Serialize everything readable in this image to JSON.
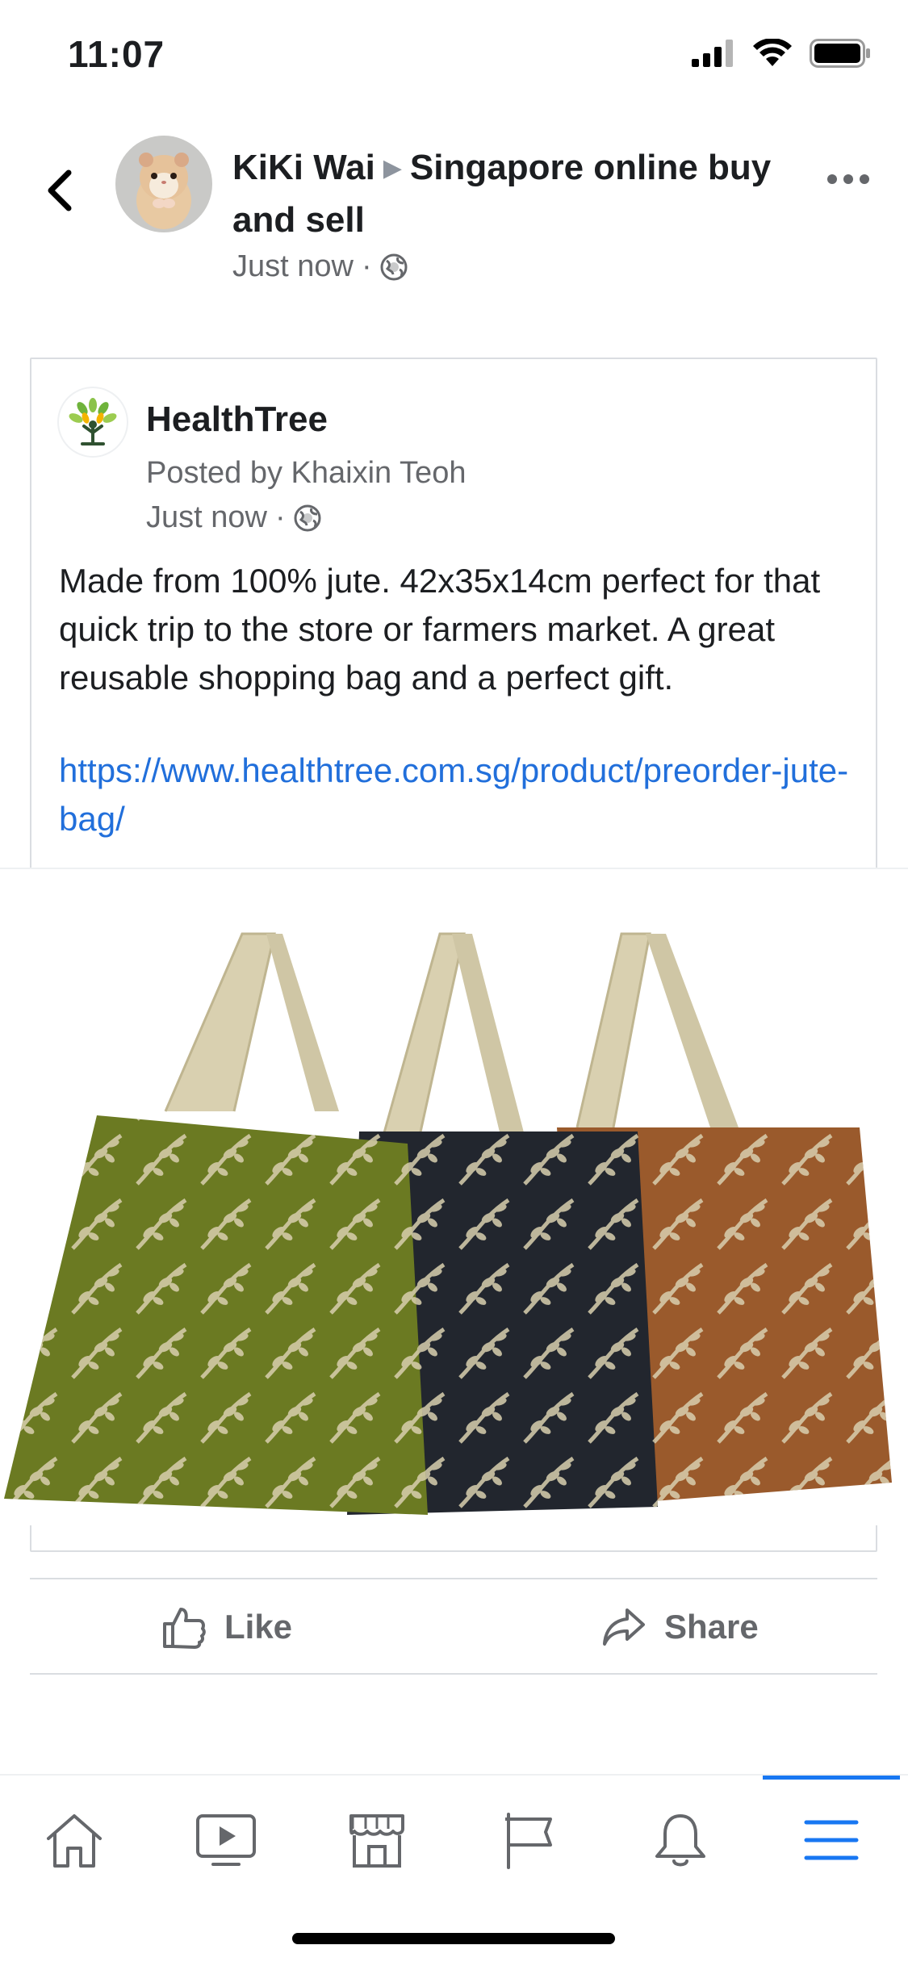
{
  "status_bar": {
    "time": "11:07"
  },
  "header": {
    "author": "KiKi Wai",
    "group": "Singapore online buy and sell",
    "timestamp": "Just now",
    "privacy_icon": "globe-icon"
  },
  "shared_post": {
    "page_name": "HealthTree",
    "posted_by": "Posted by Khaixin Teoh",
    "timestamp": "Just now",
    "body": "Made from 100% jute. 42x35x14cm perfect for that quick trip to the store or farmers market. A great reusable shopping bag and a perfect gift.",
    "link": "https://www.healthtree.com.sg/product/preorder-jute-bag/"
  },
  "actions": {
    "like_label": "Like",
    "share_label": "Share"
  },
  "bottom_nav": {
    "items": [
      "home-icon",
      "watch-icon",
      "marketplace-icon",
      "pages-icon",
      "notifications-icon",
      "menu-icon"
    ],
    "active": "menu-icon"
  },
  "colors": {
    "link": "#216fdb",
    "active": "#1877f2",
    "secondary_text": "#65676b"
  }
}
